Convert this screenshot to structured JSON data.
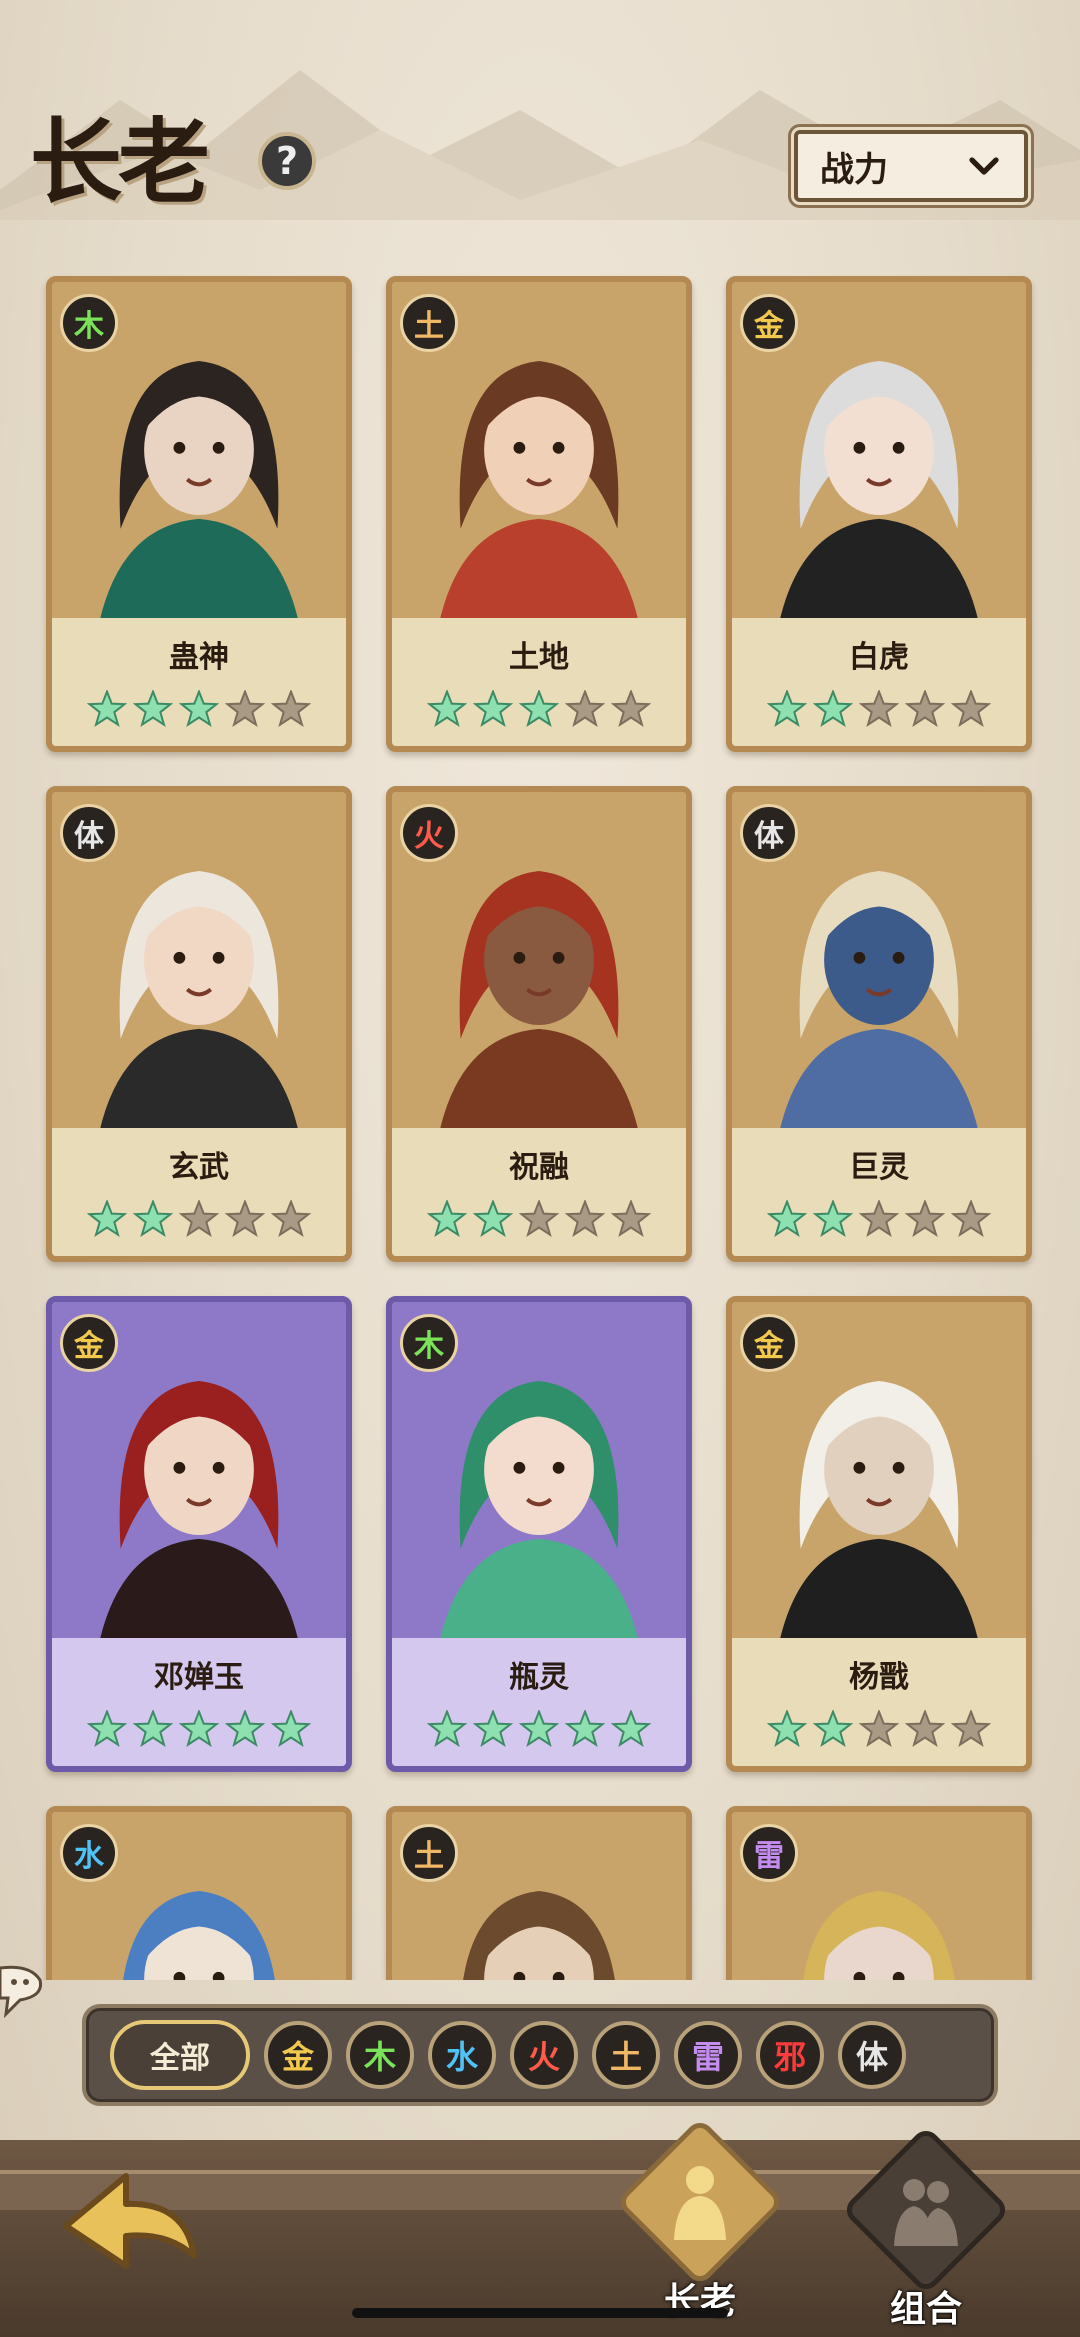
{
  "header": {
    "title": "长老",
    "help_label": "?",
    "sort_label": "战力"
  },
  "cards": [
    {
      "name": "蛊神",
      "element": "木",
      "element_color": "#7be35a",
      "stars": 3,
      "rarity": "gold"
    },
    {
      "name": "土地",
      "element": "土",
      "element_color": "#f0b866",
      "stars": 3,
      "rarity": "gold"
    },
    {
      "name": "白虎",
      "element": "金",
      "element_color": "#f2c94c",
      "stars": 2,
      "rarity": "gold"
    },
    {
      "name": "玄武",
      "element": "体",
      "element_color": "#e6e6e6",
      "stars": 2,
      "rarity": "gold"
    },
    {
      "name": "祝融",
      "element": "火",
      "element_color": "#ff5a4a",
      "stars": 2,
      "rarity": "gold"
    },
    {
      "name": "巨灵",
      "element": "体",
      "element_color": "#e6e6e6",
      "stars": 2,
      "rarity": "gold"
    },
    {
      "name": "邓婵玉",
      "element": "金",
      "element_color": "#f2c94c",
      "stars": 5,
      "rarity": "purple"
    },
    {
      "name": "瓶灵",
      "element": "木",
      "element_color": "#7be35a",
      "stars": 5,
      "rarity": "purple"
    },
    {
      "name": "杨戬",
      "element": "金",
      "element_color": "#f2c94c",
      "stars": 2,
      "rarity": "gold"
    },
    {
      "name": "",
      "element": "水",
      "element_color": "#4fc3f7",
      "stars": 0,
      "rarity": "gold"
    },
    {
      "name": "",
      "element": "土",
      "element_color": "#f0b866",
      "stars": 0,
      "rarity": "gold"
    },
    {
      "name": "",
      "element": "雷",
      "element_color": "#c58cf0",
      "stars": 0,
      "rarity": "gold"
    }
  ],
  "filters": {
    "all_label": "全部",
    "elements": [
      {
        "label": "金",
        "color": "#f2c94c"
      },
      {
        "label": "木",
        "color": "#7be35a"
      },
      {
        "label": "水",
        "color": "#4fc3f7"
      },
      {
        "label": "火",
        "color": "#ff5a4a"
      },
      {
        "label": "土",
        "color": "#f0b866"
      },
      {
        "label": "雷",
        "color": "#c58cf0"
      },
      {
        "label": "邪",
        "color": "#ff3b3b"
      },
      {
        "label": "体",
        "color": "#e6e6e6"
      }
    ]
  },
  "nav": {
    "elders_label": "长老",
    "team_label": "组合"
  },
  "colors": {
    "star_on": "#8fe0b0",
    "star_off": "#a89a84"
  }
}
